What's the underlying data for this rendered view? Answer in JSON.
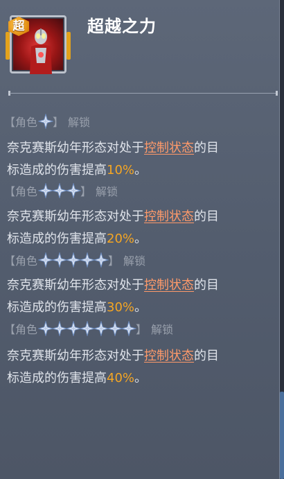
{
  "skill": {
    "badge": "超",
    "name": "超越之力"
  },
  "tiers": [
    {
      "label_open": "【角色",
      "label_close": "】",
      "stars": 1,
      "unlock": "解锁",
      "desc_a": "奈克赛斯幼年形态对处于",
      "keyword": "控制状态",
      "desc_b": "的目",
      "desc_c": "标造成的伤害提高",
      "value": "10%",
      "end": "。"
    },
    {
      "label_open": "【角色",
      "label_close": "】",
      "stars": 3,
      "unlock": "解锁",
      "desc_a": "奈克赛斯幼年形态对处于",
      "keyword": "控制状态",
      "desc_b": "的目",
      "desc_c": "标造成的伤害提高",
      "value": "20%",
      "end": "。"
    },
    {
      "label_open": "【角色",
      "label_close": "】",
      "stars": 5,
      "unlock": "解锁",
      "desc_a": "奈克赛斯幼年形态对处于",
      "keyword": "控制状态",
      "desc_b": "的目",
      "desc_c": "标造成的伤害提高",
      "value": "30%",
      "end": "。"
    },
    {
      "label_open": "【角色",
      "label_close": "】",
      "stars": 7,
      "unlock": "解锁",
      "desc_a": "奈克赛斯幼年形态对处于",
      "keyword": "控制状态",
      "desc_b": "的目",
      "desc_c": "标造成的伤害提高",
      "value": "40%",
      "end": "。"
    }
  ],
  "icons": {
    "star": "four-point-star-icon",
    "portrait": "ultraman-portrait"
  },
  "colors": {
    "panel": "#58627a",
    "keyword": "#ff9a6a",
    "percent": "#f5a623",
    "badge": "#f0a020"
  }
}
